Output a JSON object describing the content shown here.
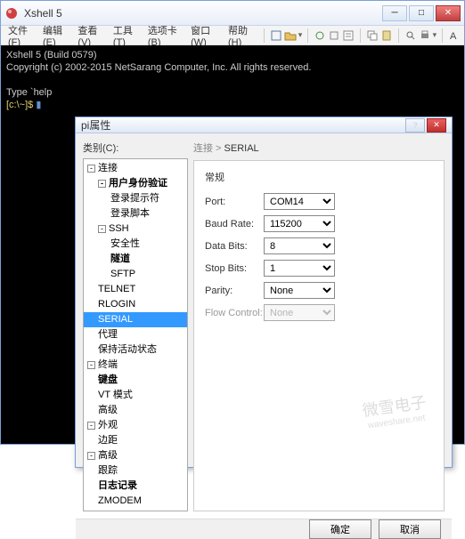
{
  "window": {
    "title": "Xshell 5",
    "menus": [
      "文件(F)",
      "编辑(E)",
      "查看(V)",
      "工具(T)",
      "选项卡(B)",
      "窗口(W)",
      "帮助(H)"
    ]
  },
  "terminal": {
    "line1": "Xshell 5 (Build 0579)",
    "line2": "Copyright (c) 2002-2015 NetSarang Computer, Inc. All rights reserved.",
    "line3_pre": "Type `help",
    "prompt": "[c:\\~]$ "
  },
  "dialog": {
    "title": "pi属性",
    "left_label": "类别(C):",
    "breadcrumb_root": "连接",
    "breadcrumb_sep": " > ",
    "breadcrumb_cur": "SERIAL",
    "group": "常规",
    "fields": {
      "port_label": "Port:",
      "port_value": "COM14",
      "baud_label": "Baud Rate:",
      "baud_value": "115200",
      "data_label": "Data Bits:",
      "data_value": "8",
      "stop_label": "Stop Bits:",
      "stop_value": "1",
      "parity_label": "Parity:",
      "parity_value": "None",
      "flow_label": "Flow Control:",
      "flow_value": "None"
    },
    "tree": [
      {
        "t": "连接",
        "l": 0,
        "exp": "-"
      },
      {
        "t": "用户身份验证",
        "l": 1,
        "exp": "-",
        "bold": true
      },
      {
        "t": "登录提示符",
        "l": 2
      },
      {
        "t": "登录脚本",
        "l": 2
      },
      {
        "t": "SSH",
        "l": 1,
        "exp": "-"
      },
      {
        "t": "安全性",
        "l": 2
      },
      {
        "t": "隧道",
        "l": 2,
        "bold": true,
        "sel": false
      },
      {
        "t": "SFTP",
        "l": 2
      },
      {
        "t": "TELNET",
        "l": 1
      },
      {
        "t": "RLOGIN",
        "l": 1
      },
      {
        "t": "SERIAL",
        "l": 1,
        "sel": true
      },
      {
        "t": "代理",
        "l": 1
      },
      {
        "t": "保持活动状态",
        "l": 1
      },
      {
        "t": "终端",
        "l": 0,
        "exp": "-"
      },
      {
        "t": "键盘",
        "l": 1,
        "bold": true
      },
      {
        "t": "VT 模式",
        "l": 1
      },
      {
        "t": "高级",
        "l": 1
      },
      {
        "t": "外观",
        "l": 0,
        "exp": "-"
      },
      {
        "t": "边距",
        "l": 1
      },
      {
        "t": "高级",
        "l": 0,
        "exp": "-"
      },
      {
        "t": "跟踪",
        "l": 1
      },
      {
        "t": "日志记录",
        "l": 1,
        "bold": true
      },
      {
        "t": "ZMODEM",
        "l": 1
      }
    ],
    "ok": "确定",
    "cancel": "取消"
  },
  "watermark": {
    "big": "微雪电子",
    "small": "waveshare.net"
  }
}
